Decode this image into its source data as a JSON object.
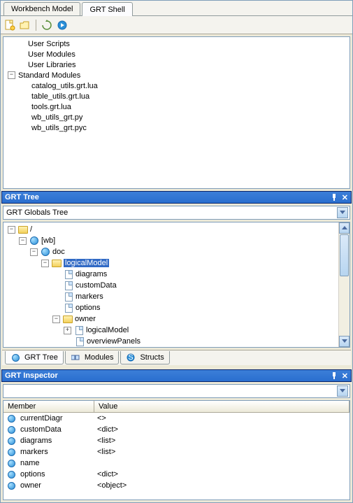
{
  "top_tabs": {
    "workbench": "Workbench Model",
    "grt_shell": "GRT Shell"
  },
  "script_tree": {
    "user_scripts": "User Scripts",
    "user_modules": "User Modules",
    "user_libraries": "User Libraries",
    "standard_modules": "Standard Modules",
    "children": {
      "catalog": "catalog_utils.grt.lua",
      "table": "table_utils.grt.lua",
      "tools": "tools.grt.lua",
      "wbpy": "wb_utils_grt.py",
      "wbpyc": "wb_utils_grt.pyc"
    }
  },
  "grt_tree_pane": {
    "title": "GRT Tree",
    "dropdown": "GRT Globals Tree",
    "nodes": {
      "root": "/",
      "wb": "[wb]",
      "doc": "doc",
      "logicalModel": "logicalModel",
      "diagrams": "diagrams",
      "customData": "customData",
      "markers": "markers",
      "options": "options",
      "owner": "owner",
      "logicalModel2": "logicalModel",
      "overviewPanels": "overviewPanels"
    }
  },
  "bottom_tabs": {
    "grt_tree": "GRT Tree",
    "modules": "Modules",
    "structs": "Structs"
  },
  "inspector": {
    "title": "GRT Inspector",
    "dropdown": "",
    "columns": {
      "member": "Member",
      "value": "Value"
    },
    "rows": [
      {
        "m": "currentDiagr",
        "v": "<>"
      },
      {
        "m": "customData",
        "v": "<dict>"
      },
      {
        "m": "diagrams",
        "v": "<list>"
      },
      {
        "m": "markers",
        "v": "<list>"
      },
      {
        "m": "name",
        "v": ""
      },
      {
        "m": "options",
        "v": "<dict>"
      },
      {
        "m": "owner",
        "v": "<object>"
      }
    ]
  }
}
